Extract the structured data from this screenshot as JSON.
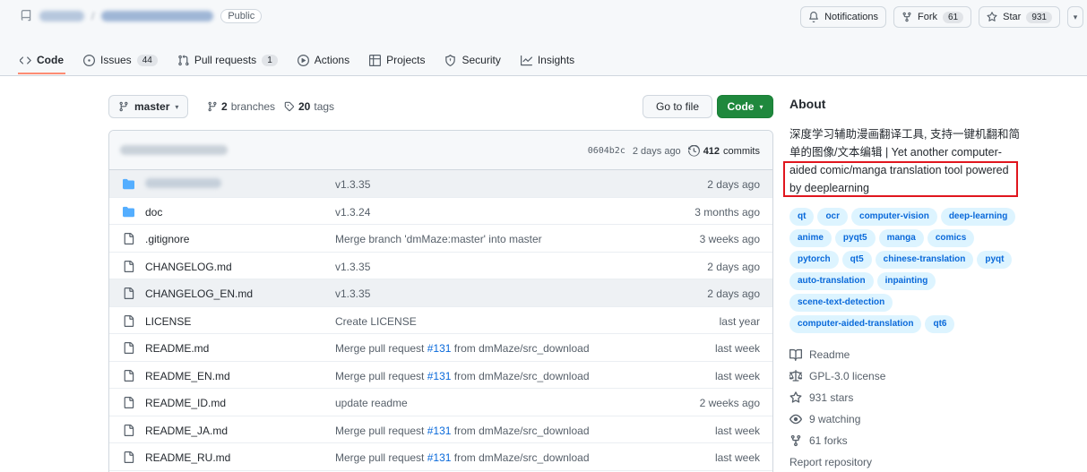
{
  "header": {
    "visibility_badge": "Public",
    "notifications_label": "Notifications",
    "fork_label": "Fork",
    "fork_count": "61",
    "star_label": "Star",
    "star_count": "931",
    "split_glyph": "▾"
  },
  "tabs": [
    {
      "label": "Code",
      "icon": "code-icon",
      "active": true
    },
    {
      "label": "Issues",
      "icon": "issues-icon",
      "count": "44"
    },
    {
      "label": "Pull requests",
      "icon": "pull-request-icon",
      "count": "1"
    },
    {
      "label": "Actions",
      "icon": "play-icon"
    },
    {
      "label": "Projects",
      "icon": "table-icon"
    },
    {
      "label": "Security",
      "icon": "shield-icon"
    },
    {
      "label": "Insights",
      "icon": "graph-icon"
    }
  ],
  "toolbar": {
    "branch": "master",
    "branch_caret": "▾",
    "branches_count": "2",
    "branches_label": "branches",
    "tags_count": "20",
    "tags_label": "tags",
    "goto_file": "Go to file",
    "code_button": "Code",
    "code_caret": "▾"
  },
  "commit_bar": {
    "sha": "0604b2c",
    "time": "2 days ago",
    "commit_count": "412",
    "commit_label": "commits"
  },
  "files": [
    {
      "type": "folder",
      "name": "",
      "message": "v1.3.35",
      "age": "2 days ago"
    },
    {
      "type": "folder",
      "name": "doc",
      "message": "v1.3.24",
      "age": "3 months ago"
    },
    {
      "type": "file",
      "name": ".gitignore",
      "message": "Merge branch 'dmMaze:master' into master",
      "age": "3 weeks ago"
    },
    {
      "type": "file",
      "name": "CHANGELOG.md",
      "message": "v1.3.35",
      "age": "2 days ago"
    },
    {
      "type": "file",
      "name": "CHANGELOG_EN.md",
      "message": "v1.3.35",
      "age": "2 days ago"
    },
    {
      "type": "file",
      "name": "LICENSE",
      "message": "Create LICENSE",
      "age": "last year"
    },
    {
      "type": "file",
      "name": "README.md",
      "message_pre": "Merge pull request ",
      "pr": "#131",
      "message_post": " from dmMaze/src_download",
      "age": "last week"
    },
    {
      "type": "file",
      "name": "README_EN.md",
      "message_pre": "Merge pull request ",
      "pr": "#131",
      "message_post": " from dmMaze/src_download",
      "age": "last week"
    },
    {
      "type": "file",
      "name": "README_ID.md",
      "message": "update readme",
      "age": "2 weeks ago"
    },
    {
      "type": "file",
      "name": "README_JA.md",
      "message_pre": "Merge pull request ",
      "pr": "#131",
      "message_post": " from dmMaze/src_download",
      "age": "last week"
    },
    {
      "type": "file",
      "name": "README_RU.md",
      "message_pre": "Merge pull request ",
      "pr": "#131",
      "message_post": " from dmMaze/src_download",
      "age": "last week"
    }
  ],
  "about": {
    "title": "About",
    "description": "深度学习辅助漫画翻译工具, 支持一键机翻和简单的图像/文本编辑 | Yet another computer-aided comic/manga translation tool powered by deeplearning",
    "topics": [
      "qt",
      "ocr",
      "computer-vision",
      "deep-learning",
      "anime",
      "pyqt5",
      "manga",
      "comics",
      "pytorch",
      "qt5",
      "chinese-translation",
      "pyqt",
      "auto-translation",
      "inpainting",
      "scene-text-detection",
      "computer-aided-translation",
      "qt6"
    ],
    "links": [
      {
        "label": "Readme",
        "icon": "book-icon"
      },
      {
        "label": "GPL-3.0 license",
        "icon": "law-icon"
      },
      {
        "label": "931 stars",
        "icon": "star-icon"
      },
      {
        "label": "9 watching",
        "icon": "eye-icon"
      },
      {
        "label": "61 forks",
        "icon": "fork-icon"
      },
      {
        "label": "Report repository",
        "icon": ""
      }
    ]
  },
  "colors": {
    "accent_green": "#1f883d",
    "tab_underline": "#fd8c73",
    "topic_bg": "#ddf4ff",
    "link_blue": "#0969da",
    "highlight_red": "#e0161e"
  }
}
